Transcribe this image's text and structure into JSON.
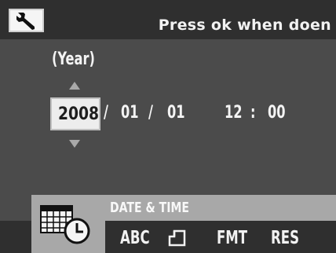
{
  "header": {
    "icon": "wrench-icon",
    "title": "Press ok when doen"
  },
  "datetime": {
    "field_label": "(Year)",
    "year": "2008",
    "sep1": "/",
    "month": "01",
    "sep2": "/",
    "day": "01",
    "hour": "12",
    "time_sep": ":",
    "minute": "00"
  },
  "menu": {
    "active_label": "DATE & TIME",
    "tabs": [
      {
        "icon": "calendar-clock-icon"
      },
      {
        "label": "ABC"
      },
      {
        "icon": "frame-icon"
      },
      {
        "label": "FMT"
      },
      {
        "label": "RES"
      }
    ]
  },
  "colors": {
    "background": "#4b4b4b",
    "bar": "#2f2f2f",
    "highlight": "#a8a8a8"
  }
}
